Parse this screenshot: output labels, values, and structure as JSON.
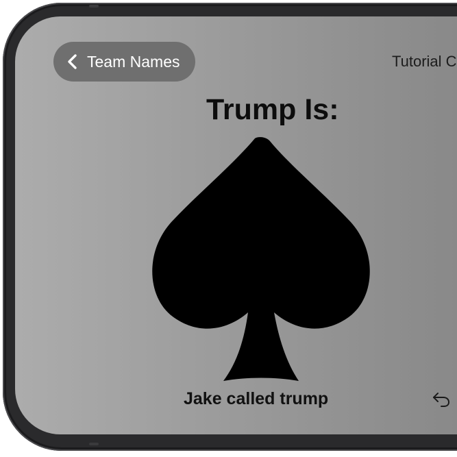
{
  "nav": {
    "back_label": "Team Names",
    "tutorial_label": "Tutorial C"
  },
  "game": {
    "trump_heading": "Trump Is:",
    "trump_suit": "spades",
    "caller_text": "Jake called trump"
  },
  "icons": {
    "back": "chevron-left-icon",
    "suit": "spade-icon",
    "undo": "undo-arrow-icon"
  },
  "colors": {
    "screen_background": "#9a9a9a",
    "back_pill": "#6f6f6f",
    "suit": "#000000",
    "bezel": "#2a2a2c"
  }
}
